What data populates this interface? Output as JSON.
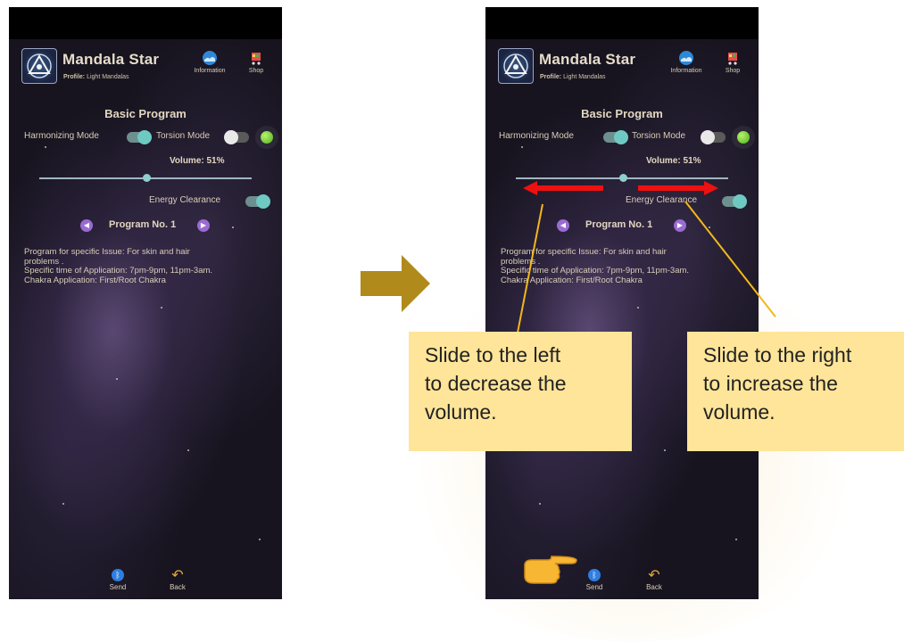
{
  "screens": [
    {
      "id": "before",
      "app": {
        "title": "Mandala Star",
        "profile_label": "Profile:",
        "profile_value": "Light Mandalas"
      },
      "header_buttons": {
        "information": "Information",
        "shop": "Shop"
      },
      "section_title": "Basic Program",
      "harmonizing_mode": {
        "label": "Harmonizing Mode",
        "on": true
      },
      "torsion_mode": {
        "label": "Torsion Mode",
        "on": false
      },
      "status_color": "#6fd23a",
      "volume": {
        "label": "Volume: 51%",
        "value": 51
      },
      "energy_clearance": {
        "label": "Energy Clearance",
        "on": true
      },
      "program": {
        "label": "Program No. 1"
      },
      "description": [
        "Program for specific Issue: For skin and hair",
        "problems .",
        "Specific time of Application: 7pm-9pm, 11pm-3am.",
        "Chakra Application: First/Root Chakra"
      ],
      "bottom": {
        "send": "Send",
        "back": "Back"
      }
    },
    {
      "id": "after",
      "app": {
        "title": "Mandala Star",
        "profile_label": "Profile:",
        "profile_value": "Light Mandalas"
      },
      "header_buttons": {
        "information": "Information",
        "shop": "Shop"
      },
      "section_title": "Basic Program",
      "harmonizing_mode": {
        "label": "Harmonizing Mode",
        "on": true
      },
      "torsion_mode": {
        "label": "Torsion Mode",
        "on": false
      },
      "status_color": "#6fd23a",
      "volume": {
        "label": "Volume: 51%",
        "value": 51
      },
      "energy_clearance": {
        "label": "Energy Clearance",
        "on": true
      },
      "program": {
        "label": "Program No. 1"
      },
      "description": [
        "Program for specific Issue: For skin and hair",
        "problems .",
        "Specific time of Application: 7pm-9pm, 11pm-3am.",
        "Chakra Application: First/Root Chakra"
      ],
      "bottom": {
        "send": "Send",
        "back": "Back"
      }
    }
  ],
  "callouts": {
    "left": [
      "Slide to the left",
      "to decrease the",
      "volume."
    ],
    "right": [
      "Slide to the right",
      "to increase the",
      "volume."
    ]
  },
  "icons": {
    "logo": "mandala-logo-icon",
    "information": "globe-icon",
    "shop": "shopping-cart-icon",
    "send": "bluetooth-icon",
    "back": "back-arrow-icon",
    "pointer": "pointing-hand-icon",
    "transition": "right-arrow-icon"
  },
  "colors": {
    "accent_teal": "#6fc9c3",
    "red_arrow": "#ee1111",
    "callout_bg": "#ffe599",
    "callout_line": "#f2b81a",
    "transition_arrow": "#b08a1a"
  }
}
